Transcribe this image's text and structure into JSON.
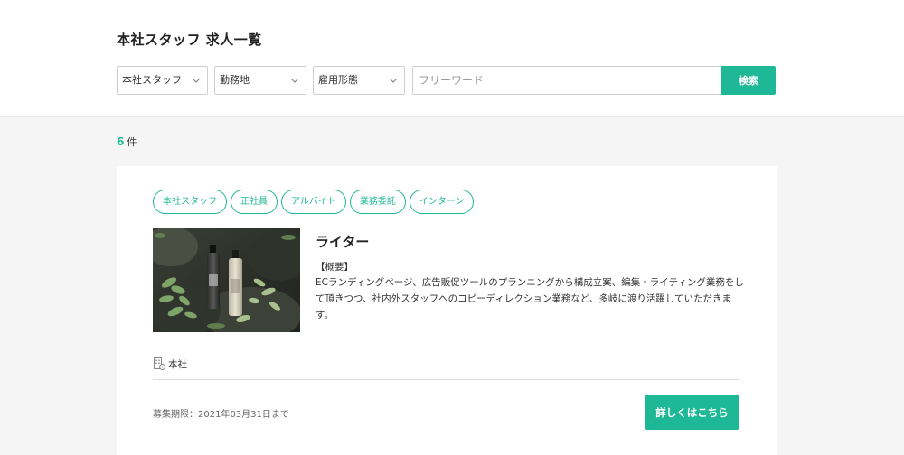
{
  "header": {
    "title": "本社スタッフ 求人一覧",
    "filters": {
      "category": "本社スタッフ",
      "location": "勤務地",
      "employment": "雇用形態"
    },
    "search": {
      "placeholder": "フリーワード",
      "button_label": "検索"
    }
  },
  "results": {
    "count": "6",
    "unit": "件"
  },
  "job": {
    "tags": [
      "本社スタッフ",
      "正社員",
      "アルバイト",
      "業務委託",
      "インターン"
    ],
    "title": "ライター",
    "overview_heading": "【概要】",
    "overview_text": "ECランディングページ、広告販促ツールのプランニングから構成立案、編集・ライティング業務をして頂きつつ、社内外スタッフへのコピーディレクション業務など、多岐に渡り活躍していただきます。",
    "location": "本社",
    "deadline": "募集期限：2021年03月31日まで",
    "detail_button": "詳しくはこちら"
  },
  "colors": {
    "accent": "#1fb896",
    "page_background": "#f5f5f5"
  },
  "icons": {
    "location": "building-pin-icon",
    "dropdown": "chevron-down-icon"
  }
}
